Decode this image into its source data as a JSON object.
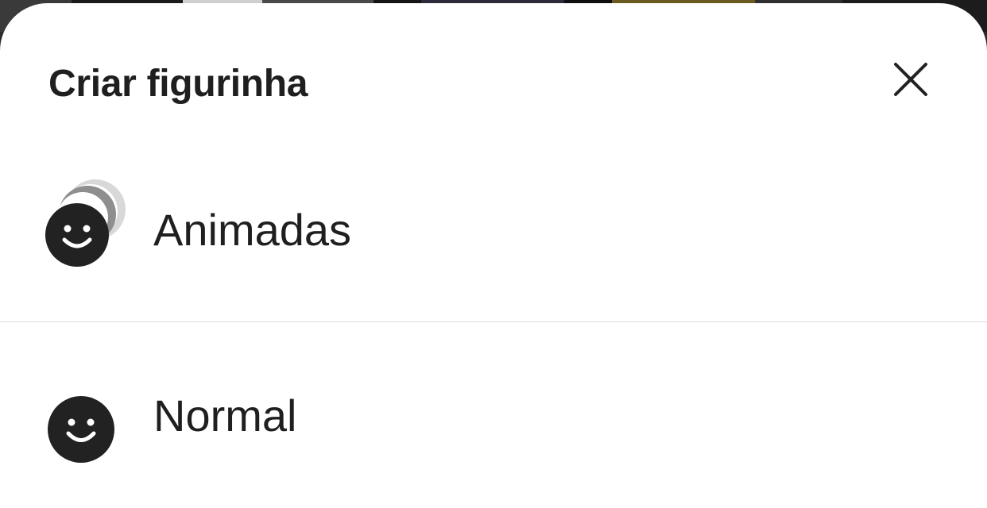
{
  "sheet": {
    "title": "Criar figurinha"
  },
  "options": [
    {
      "label": "Animadas",
      "icon": "animated-sticker-icon"
    },
    {
      "label": "Normal",
      "icon": "sticker-icon"
    }
  ],
  "colors": {
    "text": "#1f1f1f",
    "icon": "#222222",
    "divider": "#dcdcdc",
    "sheet_bg": "#ffffff"
  }
}
